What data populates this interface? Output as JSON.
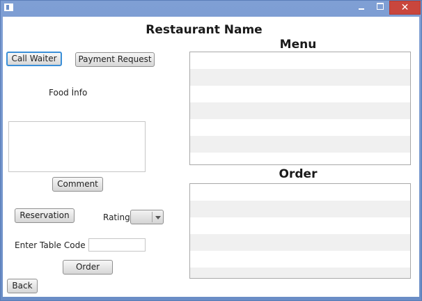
{
  "window": {
    "title": ""
  },
  "page": {
    "title": "Restaurant Name"
  },
  "buttons": {
    "call_waiter": "Call Waiter",
    "payment_request": "Payment Request",
    "comment": "Comment",
    "reservation": "Reservation",
    "order": "Order",
    "back": "Back"
  },
  "labels": {
    "food_info": "Food İnfo",
    "rating": "Rating",
    "enter_table_code": "Enter Table Code"
  },
  "inputs": {
    "comment_text": "",
    "table_code": "",
    "rating_selected": ""
  },
  "menu": {
    "title": "Menu",
    "items": []
  },
  "order": {
    "title": "Order",
    "items": []
  },
  "icons": {
    "app": "app-window-icon",
    "minimize": "minimize-icon",
    "maximize": "maximize-icon",
    "close": "close-icon",
    "dropdown": "chevron-down-icon"
  },
  "colors": {
    "titlebar": "#6d8fc7",
    "close_button": "#c9463d",
    "focus_ring": "#3a8fd8",
    "row_alt": "#f0f0f0"
  }
}
